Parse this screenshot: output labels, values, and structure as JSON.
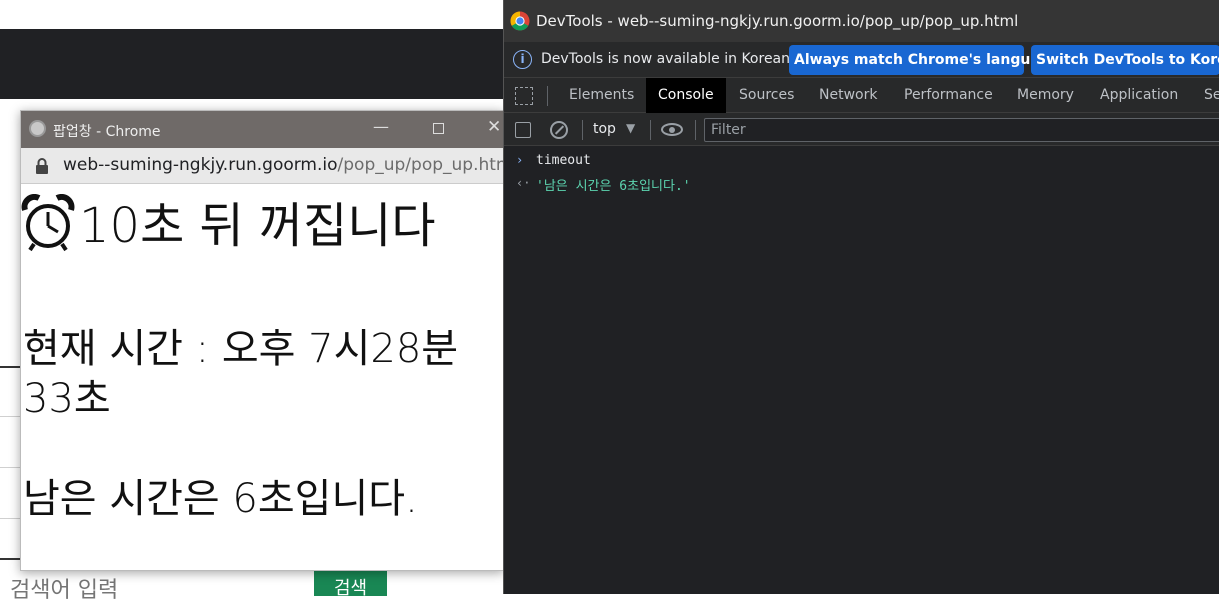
{
  "background_page": {
    "search_placeholder": "검색어 입력",
    "search_button": "검색"
  },
  "popup": {
    "window_title": "팝업창 - Chrome",
    "url_host": "web--suming-ngkjy.run.goorm.io",
    "url_path": "/pop_up/pop_up.html",
    "heading": "10초 뒤 꺼집니다",
    "current_time_line1": "현재 시간 : 오후 7시28분",
    "current_time_line2": "33초",
    "remaining": "남은 시간은 6초입니다."
  },
  "devtools": {
    "window_title": "DevTools - web--suming-ngkjy.run.goorm.io/pop_up/pop_up.html",
    "infobar_text": "DevTools is now available in Korean!",
    "infobar_btn_match": "Always match Chrome's language",
    "infobar_btn_switch": "Switch DevTools to Korean",
    "tabs": [
      "Elements",
      "Console",
      "Sources",
      "Network",
      "Performance",
      "Memory",
      "Application",
      "Se"
    ],
    "active_tab": "Console",
    "context": "top",
    "filter_placeholder": "Filter",
    "console_lines": [
      {
        "prompt": "›",
        "text": "timeout"
      },
      {
        "prompt": "‹·",
        "text": "'남은 시간은 6초입니다.'"
      }
    ],
    "colors": {
      "accent_button": "#1967d2",
      "input_text": "#e8eaed",
      "result_string": "#5cd5b0"
    }
  }
}
